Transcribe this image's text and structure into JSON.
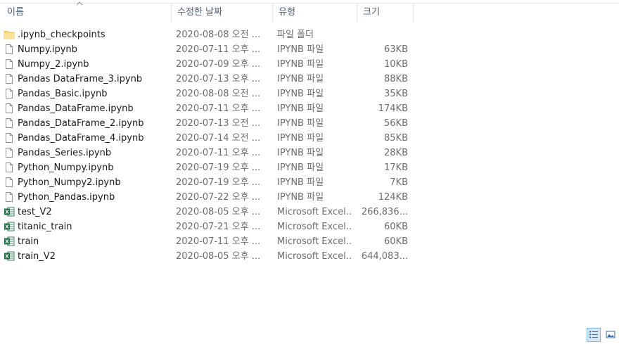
{
  "columns": {
    "name": "이름",
    "date": "수정한 날짜",
    "type": "유형",
    "size": "크기"
  },
  "files": [
    {
      "icon": "folder-icon",
      "name": ".ipynb_checkpoints",
      "date": "2020-08-08 오전 ...",
      "type": "파일 폴더",
      "size": ""
    },
    {
      "icon": "file-icon",
      "name": "Numpy.ipynb",
      "date": "2020-07-11 오후 ...",
      "type": "IPYNB 파일",
      "size": "63KB"
    },
    {
      "icon": "file-icon",
      "name": "Numpy_2.ipynb",
      "date": "2020-07-09 오후 ...",
      "type": "IPYNB 파일",
      "size": "10KB"
    },
    {
      "icon": "file-icon",
      "name": "Pandas DataFrame_3.ipynb",
      "date": "2020-07-13 오후 ...",
      "type": "IPYNB 파일",
      "size": "88KB"
    },
    {
      "icon": "file-icon",
      "name": "Pandas_Basic.ipynb",
      "date": "2020-08-08 오전 ...",
      "type": "IPYNB 파일",
      "size": "35KB"
    },
    {
      "icon": "file-icon",
      "name": "Pandas_DataFrame.ipynb",
      "date": "2020-07-11 오후 ...",
      "type": "IPYNB 파일",
      "size": "174KB"
    },
    {
      "icon": "file-icon",
      "name": "Pandas_DataFrame_2.ipynb",
      "date": "2020-07-13 오전 ...",
      "type": "IPYNB 파일",
      "size": "56KB"
    },
    {
      "icon": "file-icon",
      "name": "Pandas_DataFrame_4.ipynb",
      "date": "2020-07-14 오전 ...",
      "type": "IPYNB 파일",
      "size": "85KB"
    },
    {
      "icon": "file-icon",
      "name": "Pandas_Series.ipynb",
      "date": "2020-07-11 오후 ...",
      "type": "IPYNB 파일",
      "size": "28KB"
    },
    {
      "icon": "file-icon",
      "name": "Python_Numpy.ipynb",
      "date": "2020-07-19 오후 ...",
      "type": "IPYNB 파일",
      "size": "17KB"
    },
    {
      "icon": "file-icon",
      "name": "Python_Numpy2.ipynb",
      "date": "2020-07-19 오후 ...",
      "type": "IPYNB 파일",
      "size": "7KB"
    },
    {
      "icon": "file-icon",
      "name": "Python_Pandas.ipynb",
      "date": "2020-07-22 오후 ...",
      "type": "IPYNB 파일",
      "size": "124KB"
    },
    {
      "icon": "excel-icon",
      "name": "test_V2",
      "date": "2020-08-05 오후 ...",
      "type": "Microsoft Excel...",
      "size": "266,836..."
    },
    {
      "icon": "excel-icon",
      "name": "titanic_train",
      "date": "2020-07-21 오후 ...",
      "type": "Microsoft Excel...",
      "size": "60KB"
    },
    {
      "icon": "excel-icon",
      "name": "train",
      "date": "2020-07-11 오후 ...",
      "type": "Microsoft Excel...",
      "size": "60KB"
    },
    {
      "icon": "excel-icon",
      "name": "train_V2",
      "date": "2020-08-05 오후 ...",
      "type": "Microsoft Excel...",
      "size": "644,083..."
    }
  ],
  "colors": {
    "header_text": "#4c607a",
    "name_text": "#1a1a1a",
    "detail_text": "#6d6d6d",
    "folder": "#f8d775",
    "excel": "#1d7044",
    "selected_view_bg": "#d5e8fb",
    "selected_view_border": "#7eb4ea"
  }
}
